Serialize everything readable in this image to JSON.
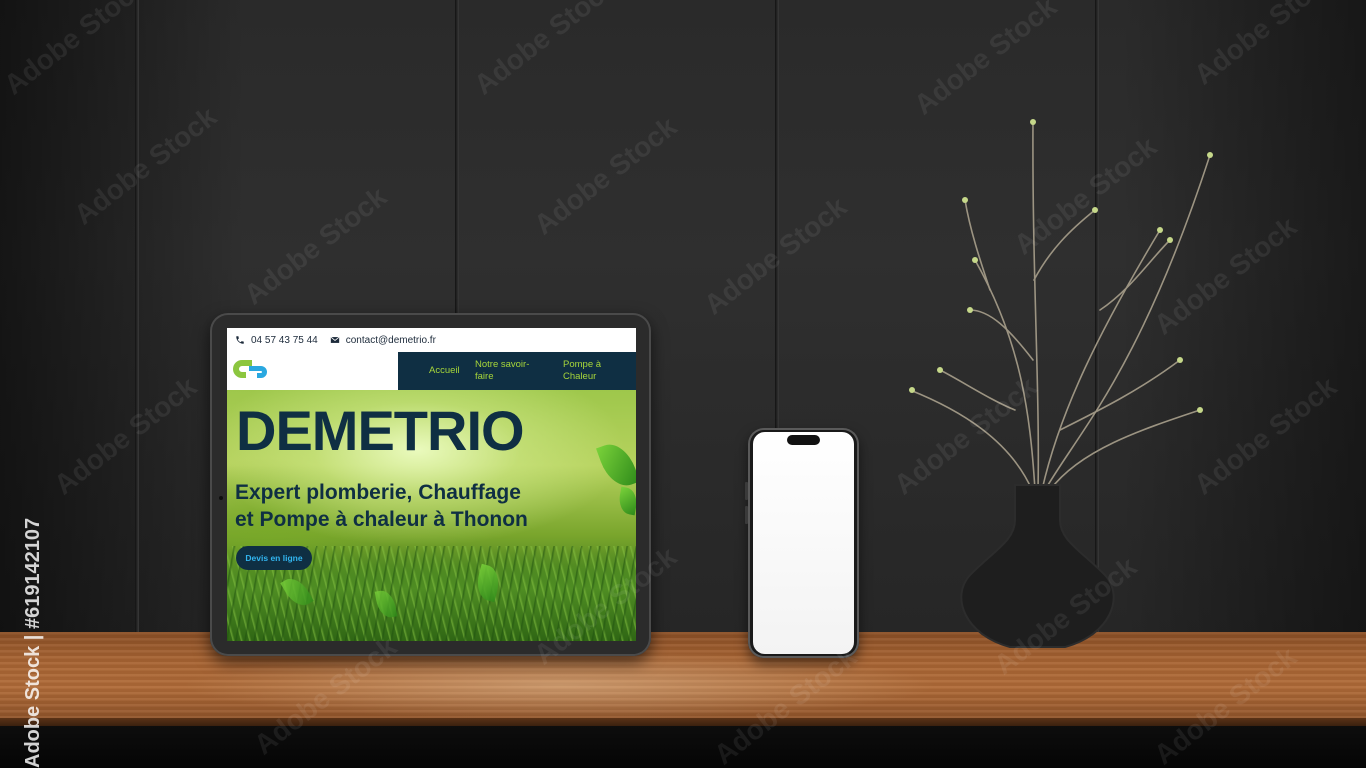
{
  "website": {
    "phone_number": "04 57 43 75 44",
    "email": "contact@demetrio.fr",
    "nav": {
      "home": "Accueil",
      "expertise": "Notre savoir-faire",
      "heat_pump": "Pompe à Chaleur"
    },
    "hero": {
      "title": "DEMETRIO",
      "subtitle_line1": "Expert plomberie, Chauffage",
      "subtitle_line2": "et Pompe à chaleur à Thonon",
      "cta": "Devis en ligne"
    },
    "colors": {
      "navy": "#0f2f43",
      "lime": "#a7d63a",
      "cta_text": "#32b6f0"
    }
  },
  "watermark": {
    "side_text": "Adobe Stock | #619142107",
    "tile_text": "Adobe Stock"
  },
  "icons": [
    "phone-icon",
    "envelope-icon"
  ]
}
